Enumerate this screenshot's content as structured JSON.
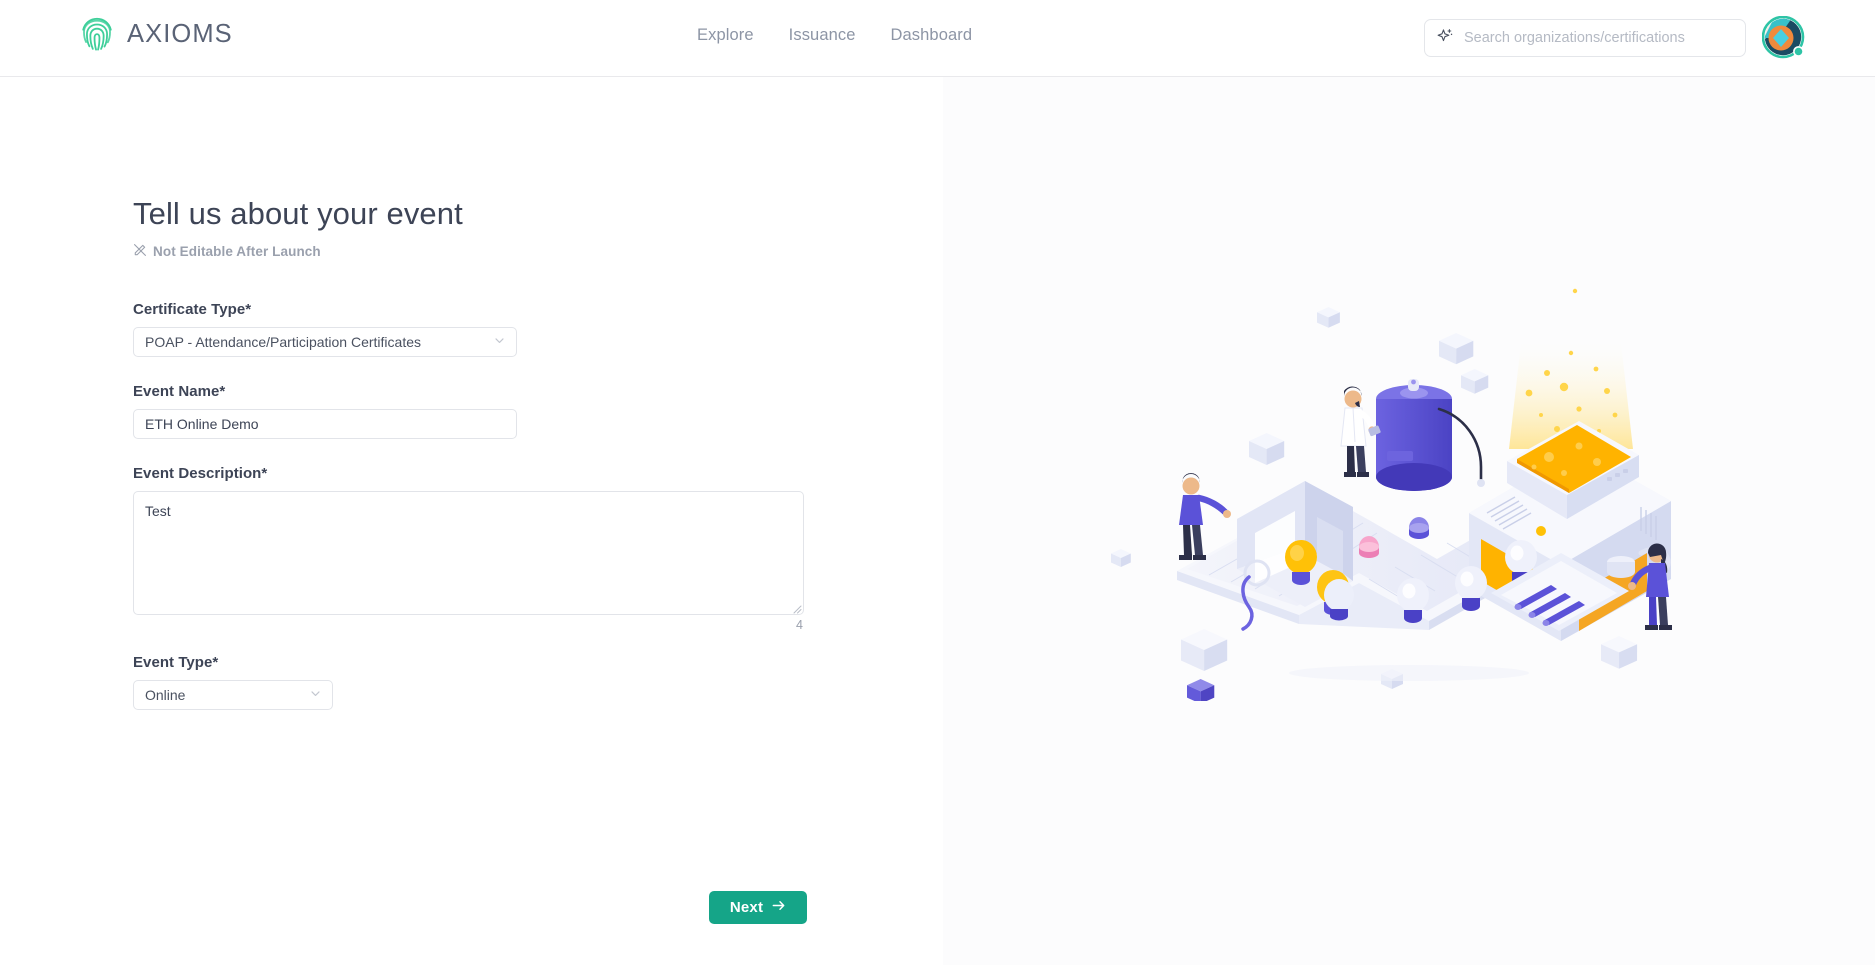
{
  "brand": {
    "name": "AXIOMS",
    "logo_icon": "fingerprint-icon",
    "logo_color": "#3ecf9a"
  },
  "nav": {
    "links": [
      {
        "label": "Explore"
      },
      {
        "label": "Issuance"
      },
      {
        "label": "Dashboard"
      }
    ]
  },
  "search": {
    "placeholder": "Search organizations/certifications",
    "value": "",
    "icon": "ai-sparkle-icon"
  },
  "account": {
    "avatar_icon": "user-avatar",
    "status": "online",
    "status_color": "#2ec4a6"
  },
  "main": {
    "title": "Tell us about your event",
    "notice": {
      "icon": "edit-disabled-icon",
      "text": "Not Editable After Launch"
    },
    "fields": {
      "certificate_type": {
        "label": "Certificate Type*",
        "value": "POAP - Attendance/Participation Certificates",
        "chevron_icon": "chevron-down-icon"
      },
      "event_name": {
        "label": "Event Name*",
        "value": "ETH Online Demo",
        "placeholder": ""
      },
      "event_description": {
        "label": "Event Description*",
        "value": "Test",
        "placeholder": "",
        "char_count": "4",
        "resize_icon": "resize-grip-icon"
      },
      "event_type": {
        "label": "Event Type*",
        "value": "Online",
        "chevron_icon": "chevron-down-icon"
      }
    },
    "next_button": {
      "label": "Next",
      "icon": "arrow-right-icon",
      "color": "#15a588"
    }
  },
  "illustration": {
    "name": "isometric-idea-factory-illustration",
    "colors": {
      "purple": "#5b52d8",
      "light_purple": "#c5c9ef",
      "yellow": "#ffc107",
      "orange": "#f9a825",
      "pale": "#eef0fb"
    }
  }
}
